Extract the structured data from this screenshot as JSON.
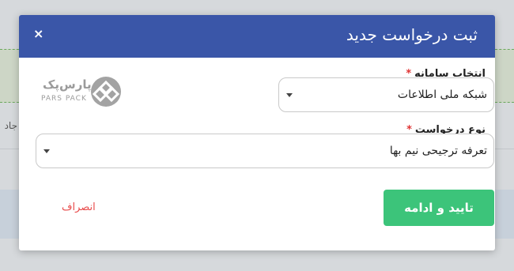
{
  "modal": {
    "title": "ثبت درخواست جدید",
    "close_symbol": "×"
  },
  "fields": {
    "system": {
      "label": "انتخاب سامانه",
      "required_mark": "*",
      "value": "شبکه ملی اطلاعات"
    },
    "request_type": {
      "label": "نوع درخواست",
      "required_mark": "*",
      "value": "تعرفه ترجیحی نیم بها"
    }
  },
  "logo": {
    "text_fa": "پارس‌پک",
    "text_en": "PARS PACK"
  },
  "actions": {
    "confirm_label": "تایید و ادامه",
    "cancel_label": "انصراف"
  },
  "background": {
    "partial_text": "جاد"
  },
  "colors": {
    "header": "#3a56a8",
    "confirm": "#3cc47a",
    "cancel": "#e84a4a",
    "required": "#e03434"
  },
  "icons": {
    "close": "close-icon",
    "dropdown": "chevron-down-icon",
    "logo": "parspack-logo-icon"
  }
}
